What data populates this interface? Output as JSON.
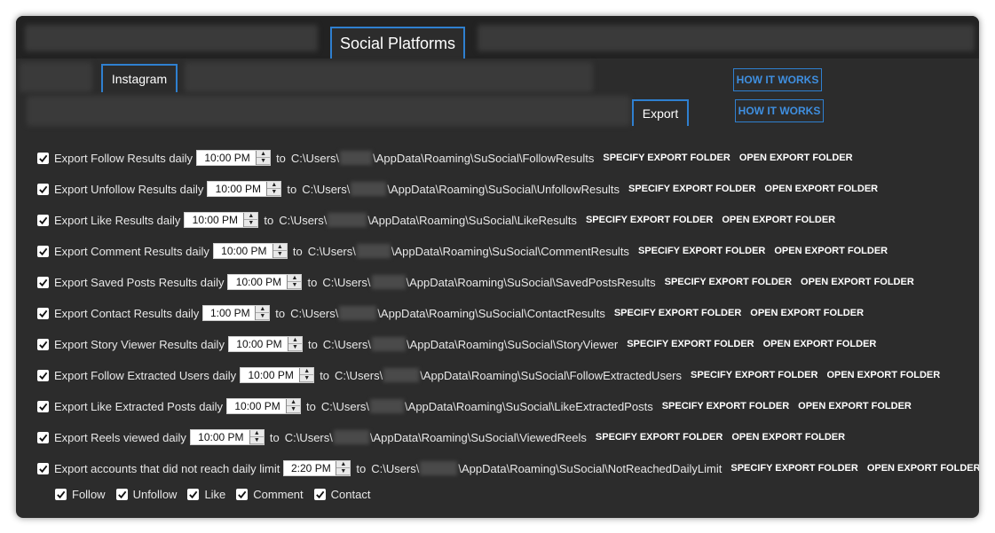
{
  "tabs": {
    "platforms": "Social Platforms",
    "instagram": "Instagram",
    "export": "Export"
  },
  "how_it_works": [
    "HOW IT WORKS",
    "HOW IT WORKS"
  ],
  "common": {
    "to": "to",
    "specify": "SPECIFY EXPORT FOLDER",
    "open": "OPEN EXPORT FOLDER",
    "path_prefix": "C:\\Users\\",
    "path_middle": "\\AppData\\Roaming\\SuSocial\\"
  },
  "rows": [
    {
      "label": "Export Follow Results daily",
      "time": "10:00 PM",
      "folder": "FollowResults",
      "checked": true
    },
    {
      "label": "Export Unfollow Results daily",
      "time": "10:00 PM",
      "folder": "UnfollowResults",
      "checked": true
    },
    {
      "label": "Export Like Results daily",
      "time": "10:00 PM",
      "folder": "LikeResults",
      "checked": true
    },
    {
      "label": "Export Comment Results daily",
      "time": "10:00 PM",
      "folder": "CommentResults",
      "checked": true
    },
    {
      "label": "Export Saved Posts Results daily",
      "time": "10:00 PM",
      "folder": "SavedPostsResults",
      "checked": true
    },
    {
      "label": "Export Contact Results daily",
      "time": "1:00 PM",
      "folder": "ContactResults",
      "checked": true
    },
    {
      "label": "Export Story Viewer Results daily",
      "time": "10:00 PM",
      "folder": "StoryViewer",
      "checked": true
    },
    {
      "label": "Export Follow Extracted Users daily",
      "time": "10:00 PM",
      "folder": "FollowExtractedUsers",
      "checked": true
    },
    {
      "label": "Export Like Extracted Posts daily",
      "time": "10:00 PM",
      "folder": "LikeExtractedPosts",
      "checked": true
    },
    {
      "label": "Export Reels viewed daily",
      "time": "10:00 PM",
      "folder": "ViewedReels",
      "checked": true
    },
    {
      "label": "Export accounts that did not reach daily limit",
      "time": "2:20 PM",
      "folder": "NotReachedDailyLimit",
      "checked": true
    }
  ],
  "sub_options": [
    {
      "label": "Follow",
      "checked": true
    },
    {
      "label": "Unfollow",
      "checked": true
    },
    {
      "label": "Like",
      "checked": true
    },
    {
      "label": "Comment",
      "checked": true
    },
    {
      "label": "Contact",
      "checked": true
    }
  ]
}
